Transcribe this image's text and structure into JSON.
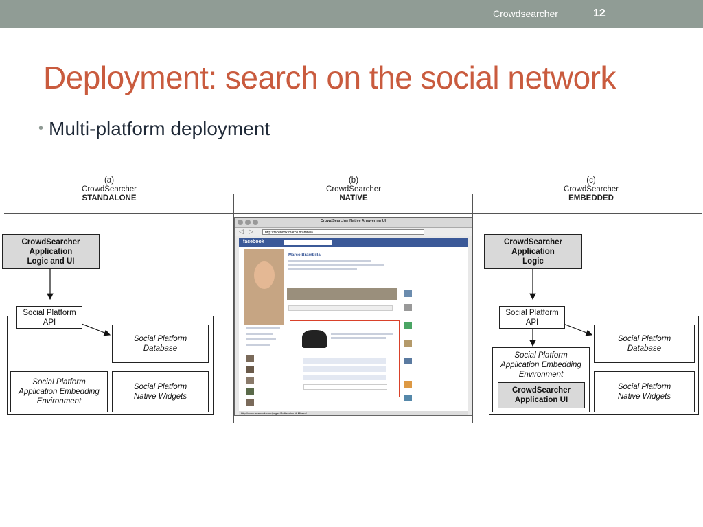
{
  "header": {
    "footer_name": "Crowdsearcher",
    "page_number": "12"
  },
  "slide": {
    "title": "Deployment: search on the social network",
    "bullets": [
      "Multi-platform deployment"
    ]
  },
  "colors": {
    "title": "#c95b3e",
    "topbar": "#909c95",
    "gray_box": "#d9d9d9",
    "highlight": "#d9412a",
    "facebook": "#3b5998"
  },
  "figure": {
    "col_a": {
      "letter": "(a)",
      "name": "CrowdSearcher",
      "mode": "STANDALONE"
    },
    "col_b": {
      "letter": "(b)",
      "name": "CrowdSearcher",
      "mode": "NATIVE"
    },
    "col_c": {
      "letter": "(c)",
      "name": "CrowdSearcher",
      "mode": "EMBEDDED"
    },
    "a": {
      "app": [
        "CrowdSearcher",
        "Application",
        "Logic and UI"
      ],
      "api": [
        "Social Platform",
        "API"
      ],
      "db": [
        "Social Platform",
        "Database"
      ],
      "env": [
        "Social Platform",
        "Application Embedding",
        "Environment"
      ],
      "widgets": [
        "Social Platform",
        "Native Widgets"
      ]
    },
    "b": {
      "window_title": "CrowdSearcher Native Answering UI",
      "url": "http://facebook/marco.brambilla",
      "site": "facebook",
      "profile_name": "Marco Brambilla",
      "status_url": "http://www.facebook.com/pages/Politecnico-di-Milano/..."
    },
    "c": {
      "app": [
        "CrowdSearcher",
        "Application",
        "Logic"
      ],
      "api": [
        "Social Platform",
        "API"
      ],
      "db": [
        "Social Platform",
        "Database"
      ],
      "env": [
        "Social Platform",
        "Application Embedding",
        "Environment"
      ],
      "ui": [
        "CrowdSearcher",
        "Application UI"
      ],
      "widgets": [
        "Social Platform",
        "Native Widgets"
      ]
    }
  }
}
